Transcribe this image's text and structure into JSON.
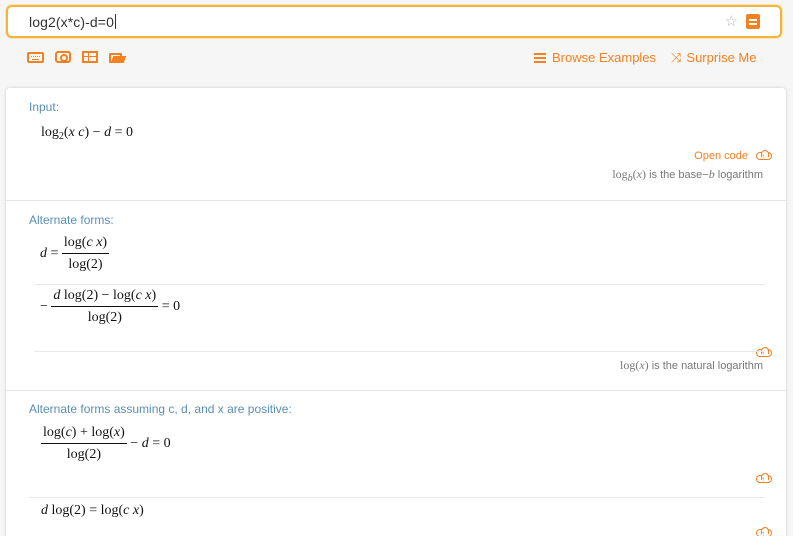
{
  "search": {
    "query": "log2(x*c)-d=0",
    "star_icon": "star-icon",
    "menu_icon": "ordered-list-icon"
  },
  "toolbar": {
    "icons": [
      "keyboard-icon",
      "camera-icon",
      "table-icon",
      "folder-icon"
    ],
    "browse_label": "Browse Examples",
    "surprise_label": "Surprise Me"
  },
  "pods": {
    "input": {
      "title": "Input:",
      "open_code": "Open code",
      "note_text": "is the base−",
      "note_suffix": "logarithm"
    },
    "alternate": {
      "title": "Alternate forms:",
      "note_text": "is the natural logarithm"
    },
    "positive": {
      "title": "Alternate forms assuming c, d, and x are positive:"
    }
  },
  "colors": {
    "accent": "#f48120",
    "search_border": "#f4b43c",
    "pod_title": "#5a8fb0"
  }
}
